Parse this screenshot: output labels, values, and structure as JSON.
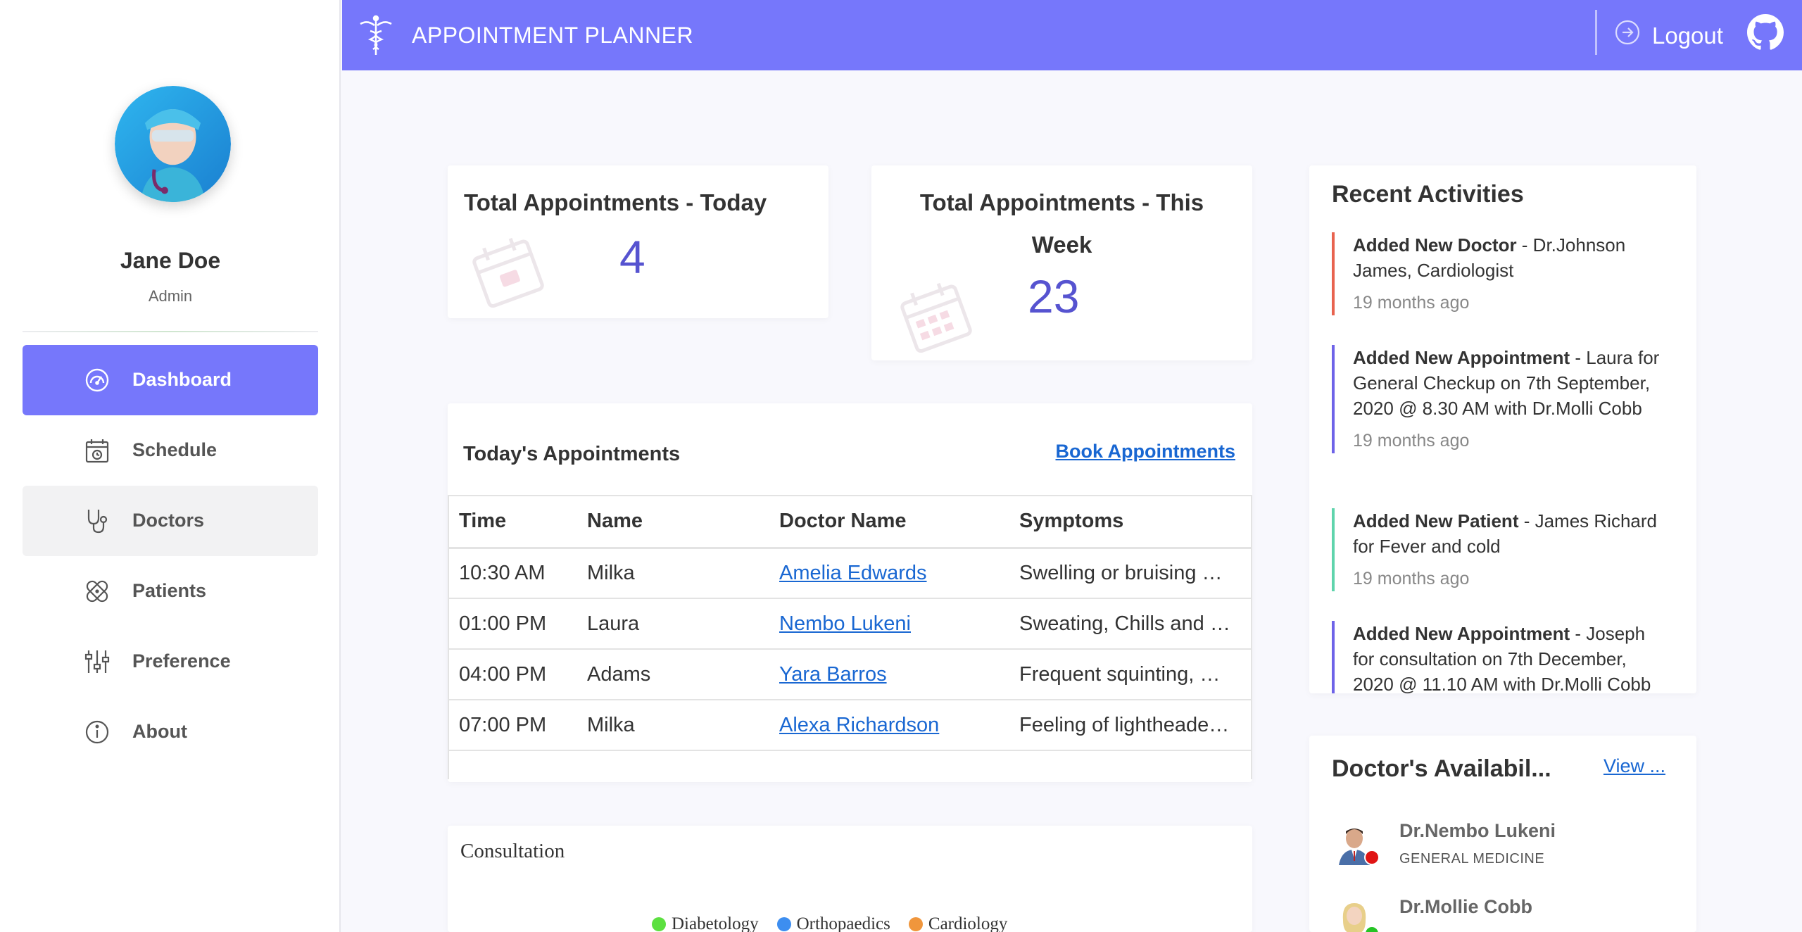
{
  "sidebar": {
    "user": {
      "name": "Jane Doe",
      "role": "Admin"
    },
    "items": [
      {
        "label": "Dashboard",
        "icon": "dashboard-gauge-icon",
        "active": true
      },
      {
        "label": "Schedule",
        "icon": "calendar-clock-icon"
      },
      {
        "label": "Doctors",
        "icon": "stethoscope-icon"
      },
      {
        "label": "Patients",
        "icon": "bandage-icon"
      },
      {
        "label": "Preference",
        "icon": "sliders-icon"
      },
      {
        "label": "About",
        "icon": "info-icon"
      }
    ]
  },
  "header": {
    "title": "APPOINTMENT PLANNER",
    "logout_label": "Logout",
    "icons": [
      "caduceus-icon",
      "logout-icon",
      "github-icon"
    ],
    "accent_color": "#7677fb"
  },
  "stats": {
    "today": {
      "title": "Total Appointments - Today",
      "value": "4"
    },
    "week": {
      "title_line1": "Total Appointments - This",
      "title_line2": "Week",
      "value": "23"
    }
  },
  "appointments": {
    "title": "Today's Appointments",
    "book_label": "Book Appointments",
    "columns": [
      "Time",
      "Name",
      "Doctor Name",
      "Symptoms"
    ],
    "rows": [
      {
        "time": "10:30 AM",
        "name": "Milka",
        "doctor": "Amelia Edwards",
        "symptoms": "Swelling or bruising …"
      },
      {
        "time": "01:00 PM",
        "name": "Laura",
        "doctor": "Nembo Lukeni",
        "symptoms": "Sweating, Chills and …"
      },
      {
        "time": "04:00 PM",
        "name": "Adams",
        "doctor": "Yara Barros",
        "symptoms": "Frequent squinting, …"
      },
      {
        "time": "07:00 PM",
        "name": "Milka",
        "doctor": "Alexa Richardson",
        "symptoms": "Feeling of lightheade…"
      }
    ]
  },
  "consultation": {
    "title": "Consultation",
    "legend": [
      {
        "label": "Diabetology",
        "color": "#5ce040"
      },
      {
        "label": "Orthopaedics",
        "color": "#3d8ef0"
      },
      {
        "label": "Cardiology",
        "color": "#f0963c"
      }
    ]
  },
  "recent": {
    "title": "Recent Activities",
    "items": [
      {
        "bold": "Added New Doctor",
        "text": " - Dr.Johnson James, Cardiologist",
        "ago": "19 months ago",
        "color": "#e8634f"
      },
      {
        "bold": "Added New Appointment",
        "text": " - Laura for General Checkup on 7th September, 2020 @ 8.30 AM with Dr.Molli Cobb",
        "ago": "19 months ago",
        "color": "#6e63e8"
      },
      {
        "bold": "Added New Patient",
        "text": " - James Richard for Fever and cold",
        "ago": "19 months ago",
        "color": "#5fd4ac"
      },
      {
        "bold": "Added New Appointment",
        "text": " - Joseph for consultation on 7th December, 2020 @ 11.10 AM with Dr.Molli Cobb",
        "ago": "",
        "color": "#6e63e8"
      }
    ]
  },
  "availability": {
    "title": "Doctor's Availabil...",
    "view_label": "View ...",
    "doctors": [
      {
        "name": "Dr.Nembo Lukeni",
        "specialty": "GENERAL MEDICINE",
        "status_color": "#e01414"
      },
      {
        "name": "Dr.Mollie Cobb",
        "specialty": "",
        "status_color": "#25c425"
      }
    ]
  }
}
